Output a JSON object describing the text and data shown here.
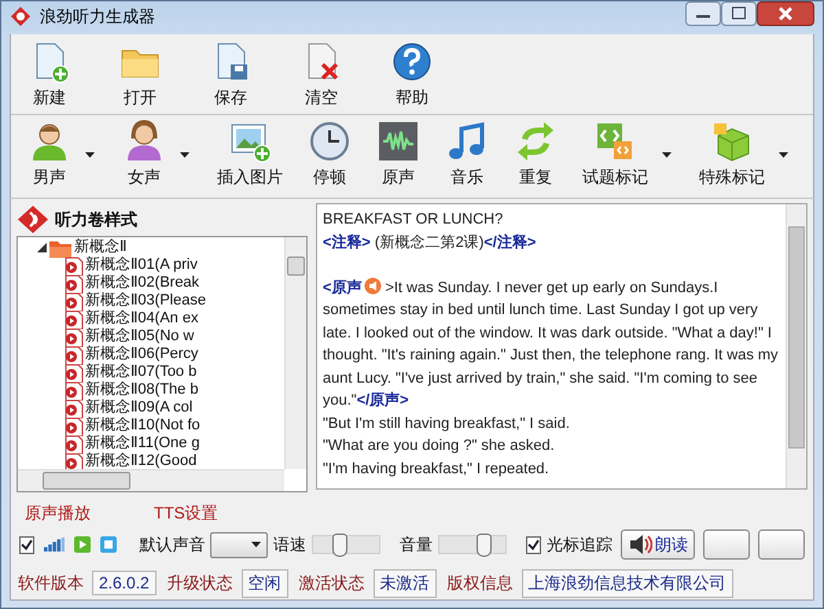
{
  "window": {
    "title": "浪劲听力生成器"
  },
  "toolbar_main": [
    {
      "label": "新建",
      "kind": "new"
    },
    {
      "label": "打开",
      "kind": "open"
    },
    {
      "label": "保存",
      "kind": "save"
    },
    {
      "label": "清空",
      "kind": "clear"
    },
    {
      "label": "帮助",
      "kind": "help"
    }
  ],
  "toolbar_insert": [
    {
      "label": "男声",
      "kind": "male",
      "dropdown": true
    },
    {
      "label": "女声",
      "kind": "female",
      "dropdown": true
    },
    {
      "label": "插入图片",
      "kind": "image",
      "dropdown": false
    },
    {
      "label": "停顿",
      "kind": "clock",
      "dropdown": false
    },
    {
      "label": "原声",
      "kind": "wave",
      "dropdown": false
    },
    {
      "label": "音乐",
      "kind": "music",
      "dropdown": false
    },
    {
      "label": "重复",
      "kind": "repeat",
      "dropdown": false
    },
    {
      "label": "试题标记",
      "kind": "code",
      "dropdown": true
    },
    {
      "label": "特殊标记",
      "kind": "cube",
      "dropdown": true
    }
  ],
  "sidebar": {
    "title": "听力卷样式",
    "tree": [
      {
        "label": "新概念Ⅱ",
        "expanded": true,
        "children": [
          {
            "label": "新概念Ⅱ01(A priv"
          },
          {
            "label": "新概念Ⅱ02(Break"
          },
          {
            "label": "新概念Ⅱ03(Please"
          },
          {
            "label": "新概念Ⅱ04(An ex"
          },
          {
            "label": "新概念Ⅱ05(No w"
          },
          {
            "label": "新概念Ⅱ06(Percy"
          },
          {
            "label": "新概念Ⅱ07(Too b"
          },
          {
            "label": "新概念Ⅱ08(The b"
          },
          {
            "label": "新概念Ⅱ09(A col"
          },
          {
            "label": "新概念Ⅱ10(Not fo"
          },
          {
            "label": "新概念Ⅱ11(One g"
          },
          {
            "label": "新概念Ⅱ12(Good"
          }
        ]
      }
    ]
  },
  "editor": {
    "blocks": [
      [
        [
          {
            "kind": "text",
            "text": "BREAKFAST OR LUNCH?"
          }
        ],
        [
          {
            "kind": "tag",
            "text": "<注释>"
          },
          {
            "kind": "text",
            "text": " (新概念二第2课)"
          },
          {
            "kind": "tag",
            "text": "</注释>"
          }
        ]
      ],
      [
        [
          {
            "kind": "tag",
            "text": "<原声"
          },
          {
            "kind": "audio"
          },
          {
            "kind": "text",
            "text": ">It was Sunday. I never get up early on Sundays.I"
          }
        ],
        [
          {
            "kind": "text",
            "text": "sometimes stay in bed until lunch time. Last Sunday I got up very"
          }
        ],
        [
          {
            "kind": "text",
            "text": "late. I looked out of the window. It was dark outside. \"What a day!\" I"
          }
        ],
        [
          {
            "kind": "text",
            "text": "thought. \"It's raining again.\" Just then, the telephone rang. It was my"
          }
        ],
        [
          {
            "kind": "text",
            "text": "aunt Lucy. \"I've just arrived by train,\" she said. \"I'm coming to see"
          }
        ],
        [
          {
            "kind": "text",
            "text": "you.\""
          },
          {
            "kind": "tag",
            "text": "</原声>"
          }
        ],
        [
          {
            "kind": "text",
            "text": "\"But I'm still having breakfast,\" I said."
          }
        ],
        [
          {
            "kind": "text",
            "text": "\"What are you doing ?\" she asked."
          }
        ],
        [
          {
            "kind": "text",
            "text": "\"I'm having breakfast,\" I repeated."
          }
        ]
      ]
    ]
  },
  "playback": {
    "title": "原声播放",
    "enabled": true
  },
  "tts": {
    "title": "TTS设置",
    "voice_label": "默认声音",
    "speed_label": "语速",
    "speed": {
      "level": 0.4
    },
    "volume_label": "音量",
    "volume": {
      "level": 0.66
    },
    "cursor_tracking": {
      "label": "光标追踪",
      "checked": true
    },
    "read_button": "朗读"
  },
  "status_bar": [
    {
      "label": "软件版本",
      "value": "2.6.0.2"
    },
    {
      "label": "升级状态",
      "value": "空闲"
    },
    {
      "label": "激活状态",
      "value": "未激活"
    },
    {
      "label": "版权信息",
      "value": "上海浪劲信息技术有限公司"
    }
  ]
}
